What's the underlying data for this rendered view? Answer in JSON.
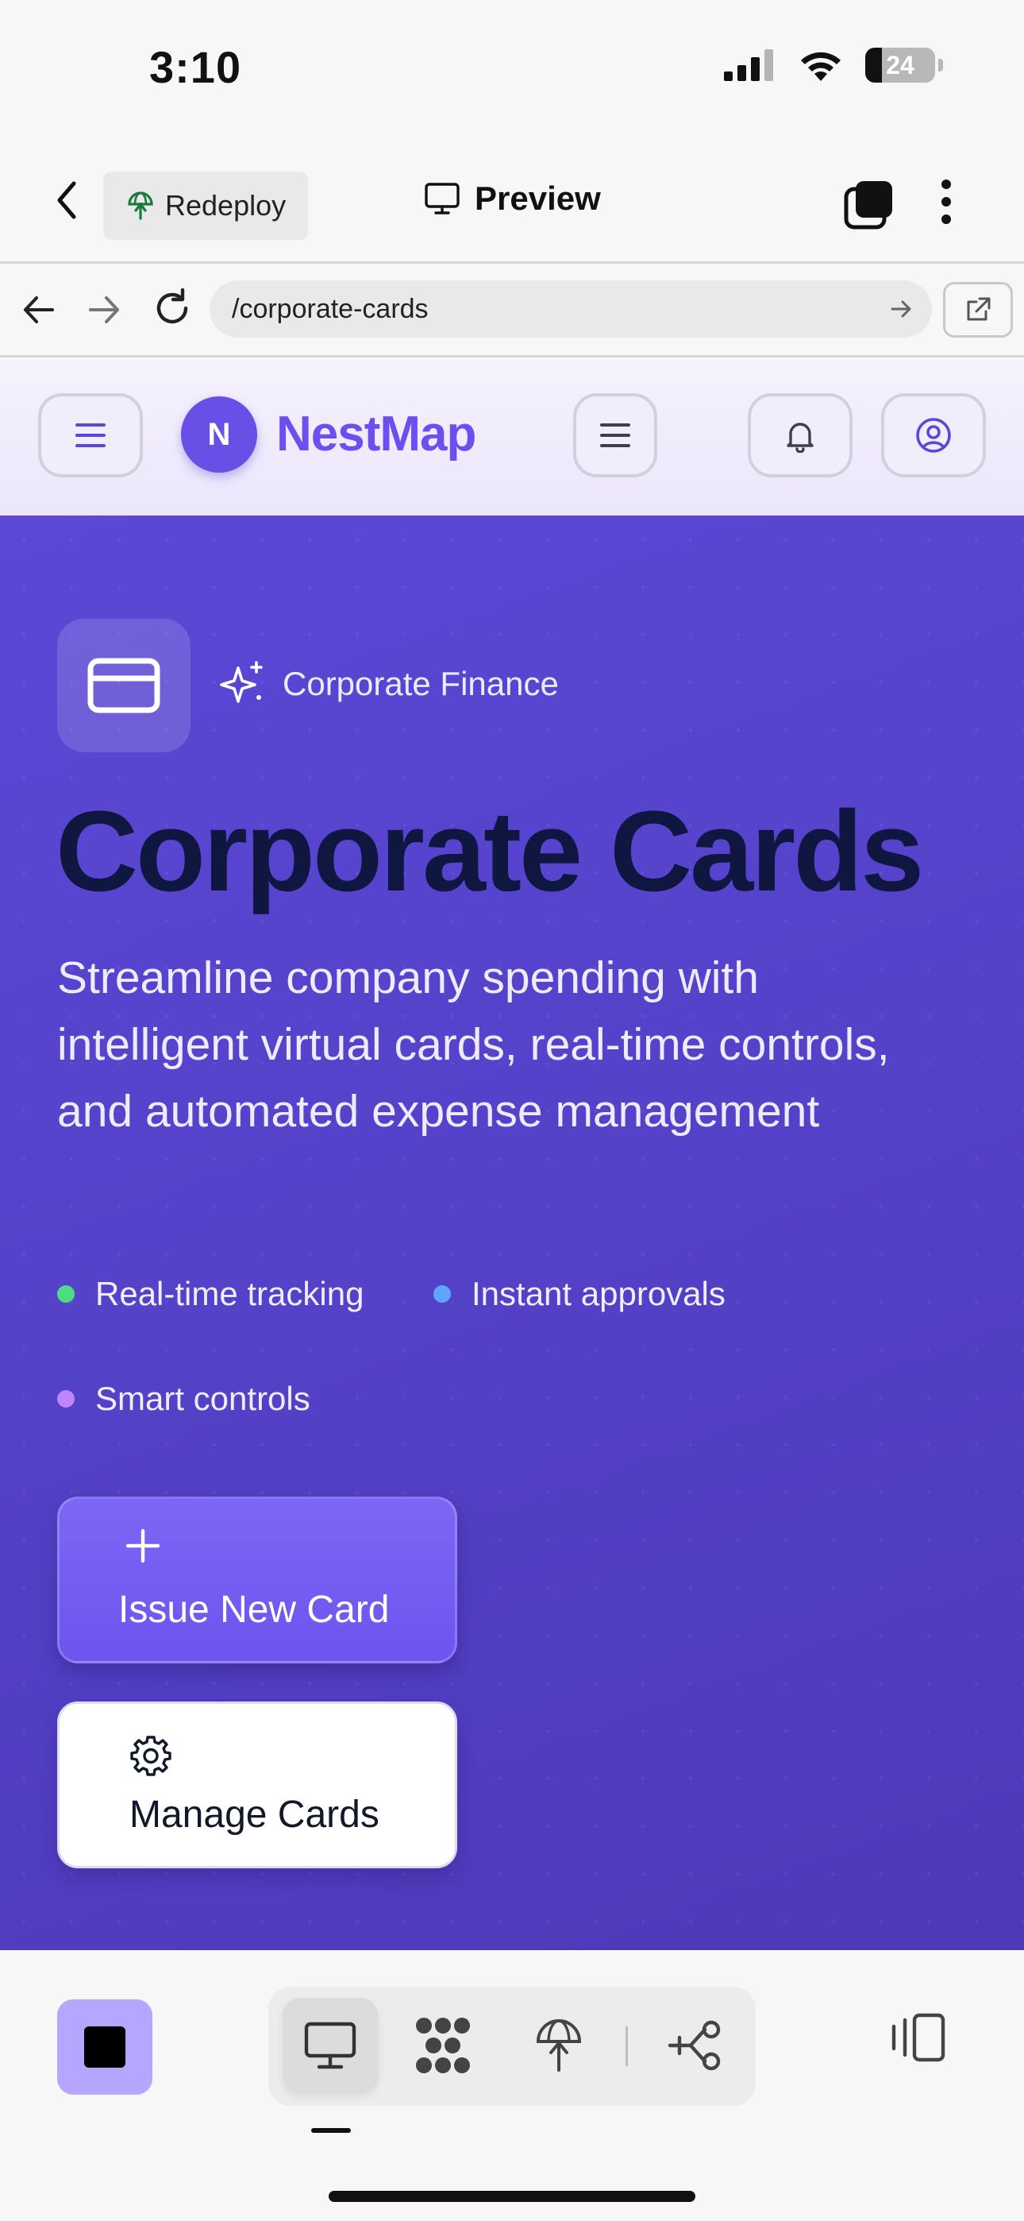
{
  "status_bar": {
    "time": "3:10",
    "battery_level": "24"
  },
  "app_header": {
    "redeploy_label": "Redeploy",
    "preview_label": "Preview"
  },
  "browser": {
    "url": "/corporate-cards"
  },
  "site_nav": {
    "logo_initial": "N",
    "brand_name": "NestMap"
  },
  "hero": {
    "eyebrow": "Corporate Finance",
    "title": "Corporate Cards",
    "subtitle": "Streamline company spending with intelligent virtual cards, real-time controls, and automated expense management",
    "features": [
      {
        "label": "Real-time tracking",
        "color": "#4ade80"
      },
      {
        "label": "Instant approvals",
        "color": "#60a5fa"
      },
      {
        "label": "Smart controls",
        "color": "#c084fc"
      }
    ],
    "primary_button": "Issue New Card",
    "secondary_button": "Manage Cards"
  },
  "colors": {
    "brand": "#6b4ff0",
    "hero_background": "#5442c9",
    "title_text": "#0f1640",
    "stop_button": "#b7a6ff"
  },
  "toolbar": {
    "icons": [
      "stop-icon",
      "desktop-icon",
      "dots-grid-icon",
      "deploy-icon",
      "flow-icon",
      "device-toggle-icon"
    ]
  }
}
